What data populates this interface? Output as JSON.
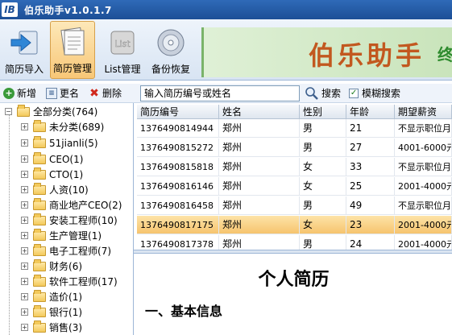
{
  "window": {
    "title": "伯乐助手v1.0.1.7",
    "logo": "IB"
  },
  "toolbar": {
    "buttons": [
      {
        "label": "简历导入",
        "icon": "import-arrow-icon"
      },
      {
        "label": "简历管理",
        "icon": "resume-manage-icon",
        "active": true
      },
      {
        "label": "List管理",
        "icon": "list-icon"
      },
      {
        "label": "备份恢复",
        "icon": "backup-disc-icon"
      }
    ]
  },
  "banner": {
    "text": "伯乐助手",
    "sub": "终"
  },
  "left_toolbar": {
    "add": "新增",
    "rename": "更名",
    "delete": "删除"
  },
  "tree": {
    "root": {
      "label": "全部分类",
      "count": "(764)"
    },
    "items": [
      {
        "label": "未分类",
        "count": "(689)"
      },
      {
        "label": "51jianli",
        "count": "(5)"
      },
      {
        "label": "CEO",
        "count": "(1)"
      },
      {
        "label": "CTO",
        "count": "(1)"
      },
      {
        "label": "人资",
        "count": "(10)"
      },
      {
        "label": "商业地产CEO",
        "count": "(2)"
      },
      {
        "label": "安装工程师",
        "count": "(10)"
      },
      {
        "label": "生产管理",
        "count": "(1)"
      },
      {
        "label": "电子工程师",
        "count": "(7)"
      },
      {
        "label": "财务",
        "count": "(6)"
      },
      {
        "label": "软件工程师",
        "count": "(17)"
      },
      {
        "label": "造价",
        "count": "(1)"
      },
      {
        "label": "银行",
        "count": "(1)"
      },
      {
        "label": "销售",
        "count": "(3)"
      }
    ]
  },
  "search": {
    "value": "输入简历编号或姓名",
    "button": "搜索",
    "fuzzy_label": "模糊搜索",
    "fuzzy_checked": true
  },
  "grid": {
    "columns": [
      "简历编号",
      "姓名",
      "性别",
      "年龄",
      "期望薪资"
    ],
    "rows": [
      [
        "1376490814944",
        "郑州",
        "男",
        "21",
        "不显示职位月"
      ],
      [
        "1376490815272",
        "郑州",
        "男",
        "27",
        "4001-6000元"
      ],
      [
        "1376490815818",
        "郑州",
        "女",
        "33",
        "不显示职位月"
      ],
      [
        "1376490816146",
        "郑州",
        "女",
        "25",
        "2001-4000元"
      ],
      [
        "1376490816458",
        "郑州",
        "男",
        "49",
        "不显示职位月"
      ],
      [
        "1376490817175",
        "郑州",
        "女",
        "23",
        "2001-4000元"
      ],
      [
        "1376490817378",
        "郑州",
        "男",
        "24",
        "2001-4000元"
      ]
    ],
    "selected_row": 5
  },
  "preview": {
    "title": "个人简历",
    "section": "一、基本信息"
  }
}
